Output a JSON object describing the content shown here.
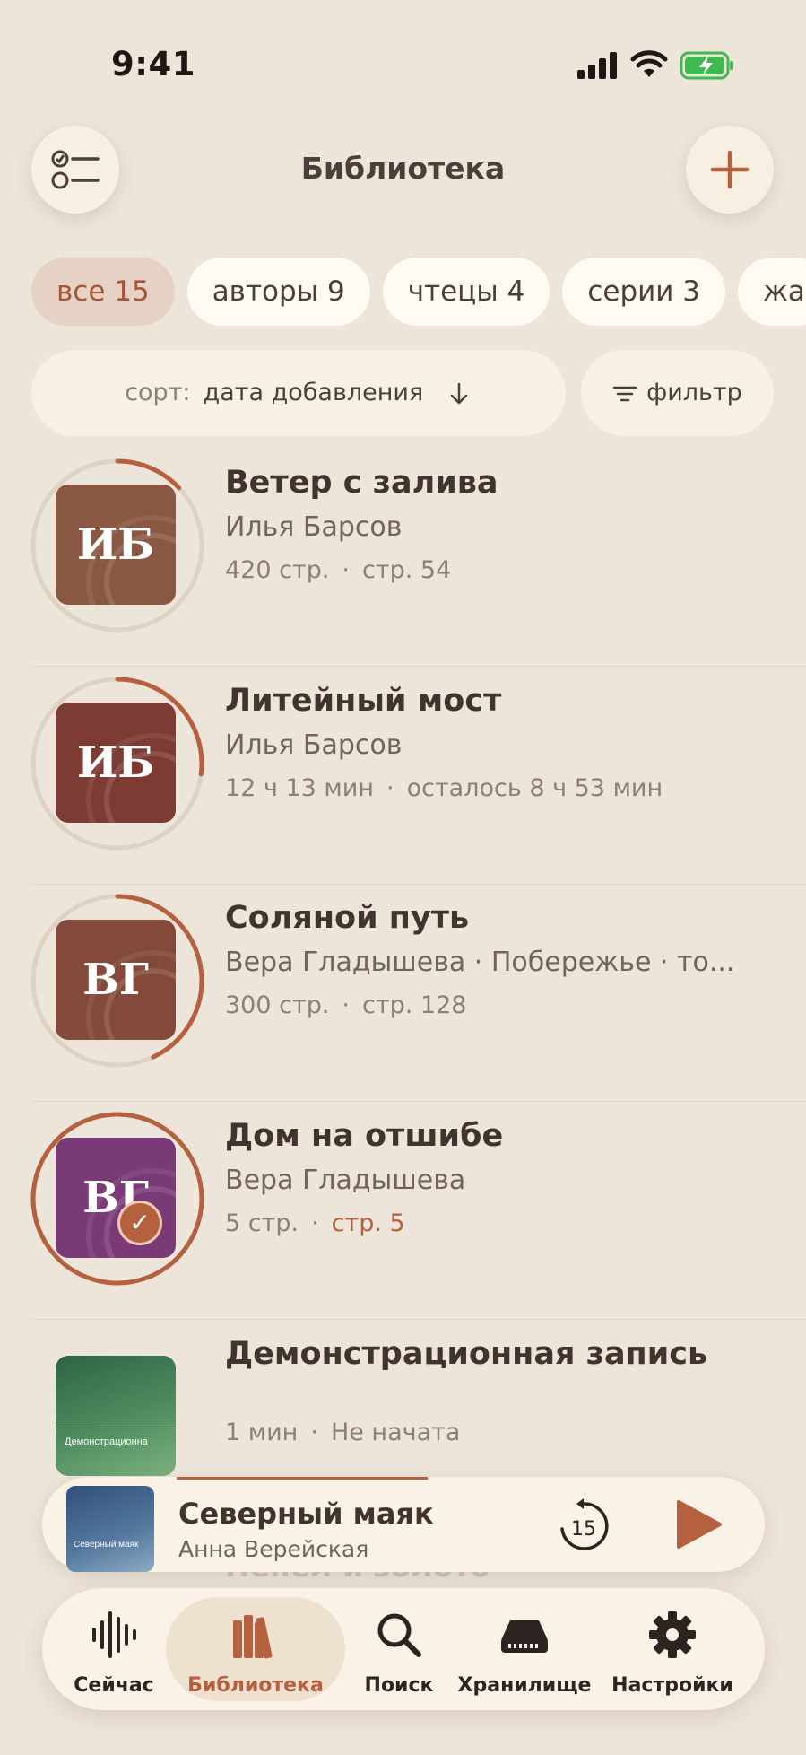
{
  "status_bar": {
    "time": "9:41"
  },
  "header": {
    "title": "Библиотека"
  },
  "chips": [
    {
      "label": "все 15",
      "active": true
    },
    {
      "label": "авторы 9",
      "active": false
    },
    {
      "label": "чтецы 4",
      "active": false
    },
    {
      "label": "серии 3",
      "active": false
    },
    {
      "label": "жа",
      "active": false
    }
  ],
  "sort": {
    "key_label": "сорт:",
    "value": "дата добавления"
  },
  "filter": {
    "label": "фильтр"
  },
  "books": [
    {
      "title": "Ветер с залива",
      "author": "Илья Барсов",
      "meta1": "420 стр.",
      "meta2": "стр. 54",
      "initials": "ИБ",
      "cover_color": "#8a5742",
      "progress": 0.13
    },
    {
      "title": "Литейный мост",
      "author": "Илья Барсов",
      "meta1": "12 ч 13 мин",
      "meta2": "осталось 8 ч 53 мин",
      "initials": "ИБ",
      "cover_color": "#7e3b34",
      "progress": 0.27
    },
    {
      "title": "Соляной путь",
      "author": "Вера Гладышева · Побережье · то...",
      "meta1": "300 стр.",
      "meta2": "стр. 128",
      "initials": "ВГ",
      "cover_color": "#83493a",
      "progress": 0.43
    },
    {
      "title": "Дом на отшибе",
      "author": "Вера Гладышева",
      "meta1": "5 стр.",
      "meta2": "стр. 5",
      "initials": "ВГ",
      "cover_color": "#7a3a78",
      "progress": 1.0,
      "finished": true
    },
    {
      "title": "Демонстрационная запись",
      "author": "",
      "meta1": "1 мин",
      "meta2": "Не начата",
      "cover_text": "Демонстрационна"
    }
  ],
  "ghost_title": "Пепел и золото",
  "mini_player": {
    "title": "Северный маяк",
    "author": "Анна Верейская",
    "cover_text": "Северный маяк",
    "skip_label": "15",
    "progress": 0.35
  },
  "tabs": [
    {
      "label": "Сейчас",
      "icon": "waveform-icon",
      "active": false
    },
    {
      "label": "Библиотека",
      "icon": "books-icon",
      "active": true
    },
    {
      "label": "Поиск",
      "icon": "search-icon",
      "active": false
    },
    {
      "label": "Хранилище",
      "icon": "storage-icon",
      "active": false
    },
    {
      "label": "Настройки",
      "icon": "gear-icon",
      "active": false
    }
  ],
  "colors": {
    "accent": "#b5603e",
    "background": "#ede5da",
    "card": "#faf2e6"
  }
}
